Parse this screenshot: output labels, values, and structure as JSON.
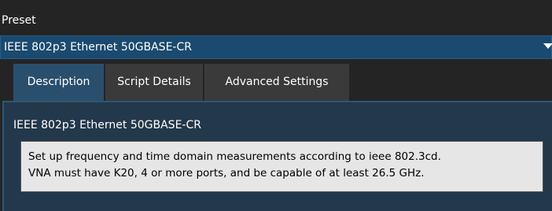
{
  "preset": {
    "label": "Preset",
    "selected": "IEEE 802p3 Ethernet 50GBASE-CR"
  },
  "tabs": [
    {
      "label": "Description",
      "active": true
    },
    {
      "label": "Script Details",
      "active": false
    },
    {
      "label": "Advanced Settings",
      "active": false
    }
  ],
  "description": {
    "title": "IEEE 802p3 Ethernet 50GBASE-CR",
    "text_line1": "Set up frequency and time domain measurements according to ieee 802.3cd.",
    "text_line2": "VNA must have K20, 4 or more ports, and be capable of at least 26.5 GHz."
  },
  "colors": {
    "background": "#242424",
    "select": "#1b4a70",
    "active_tab": "#2a4f6c",
    "inactive_tab": "#3a3a3a",
    "panel": "#23384a",
    "description_box": "#e6e6e6"
  }
}
